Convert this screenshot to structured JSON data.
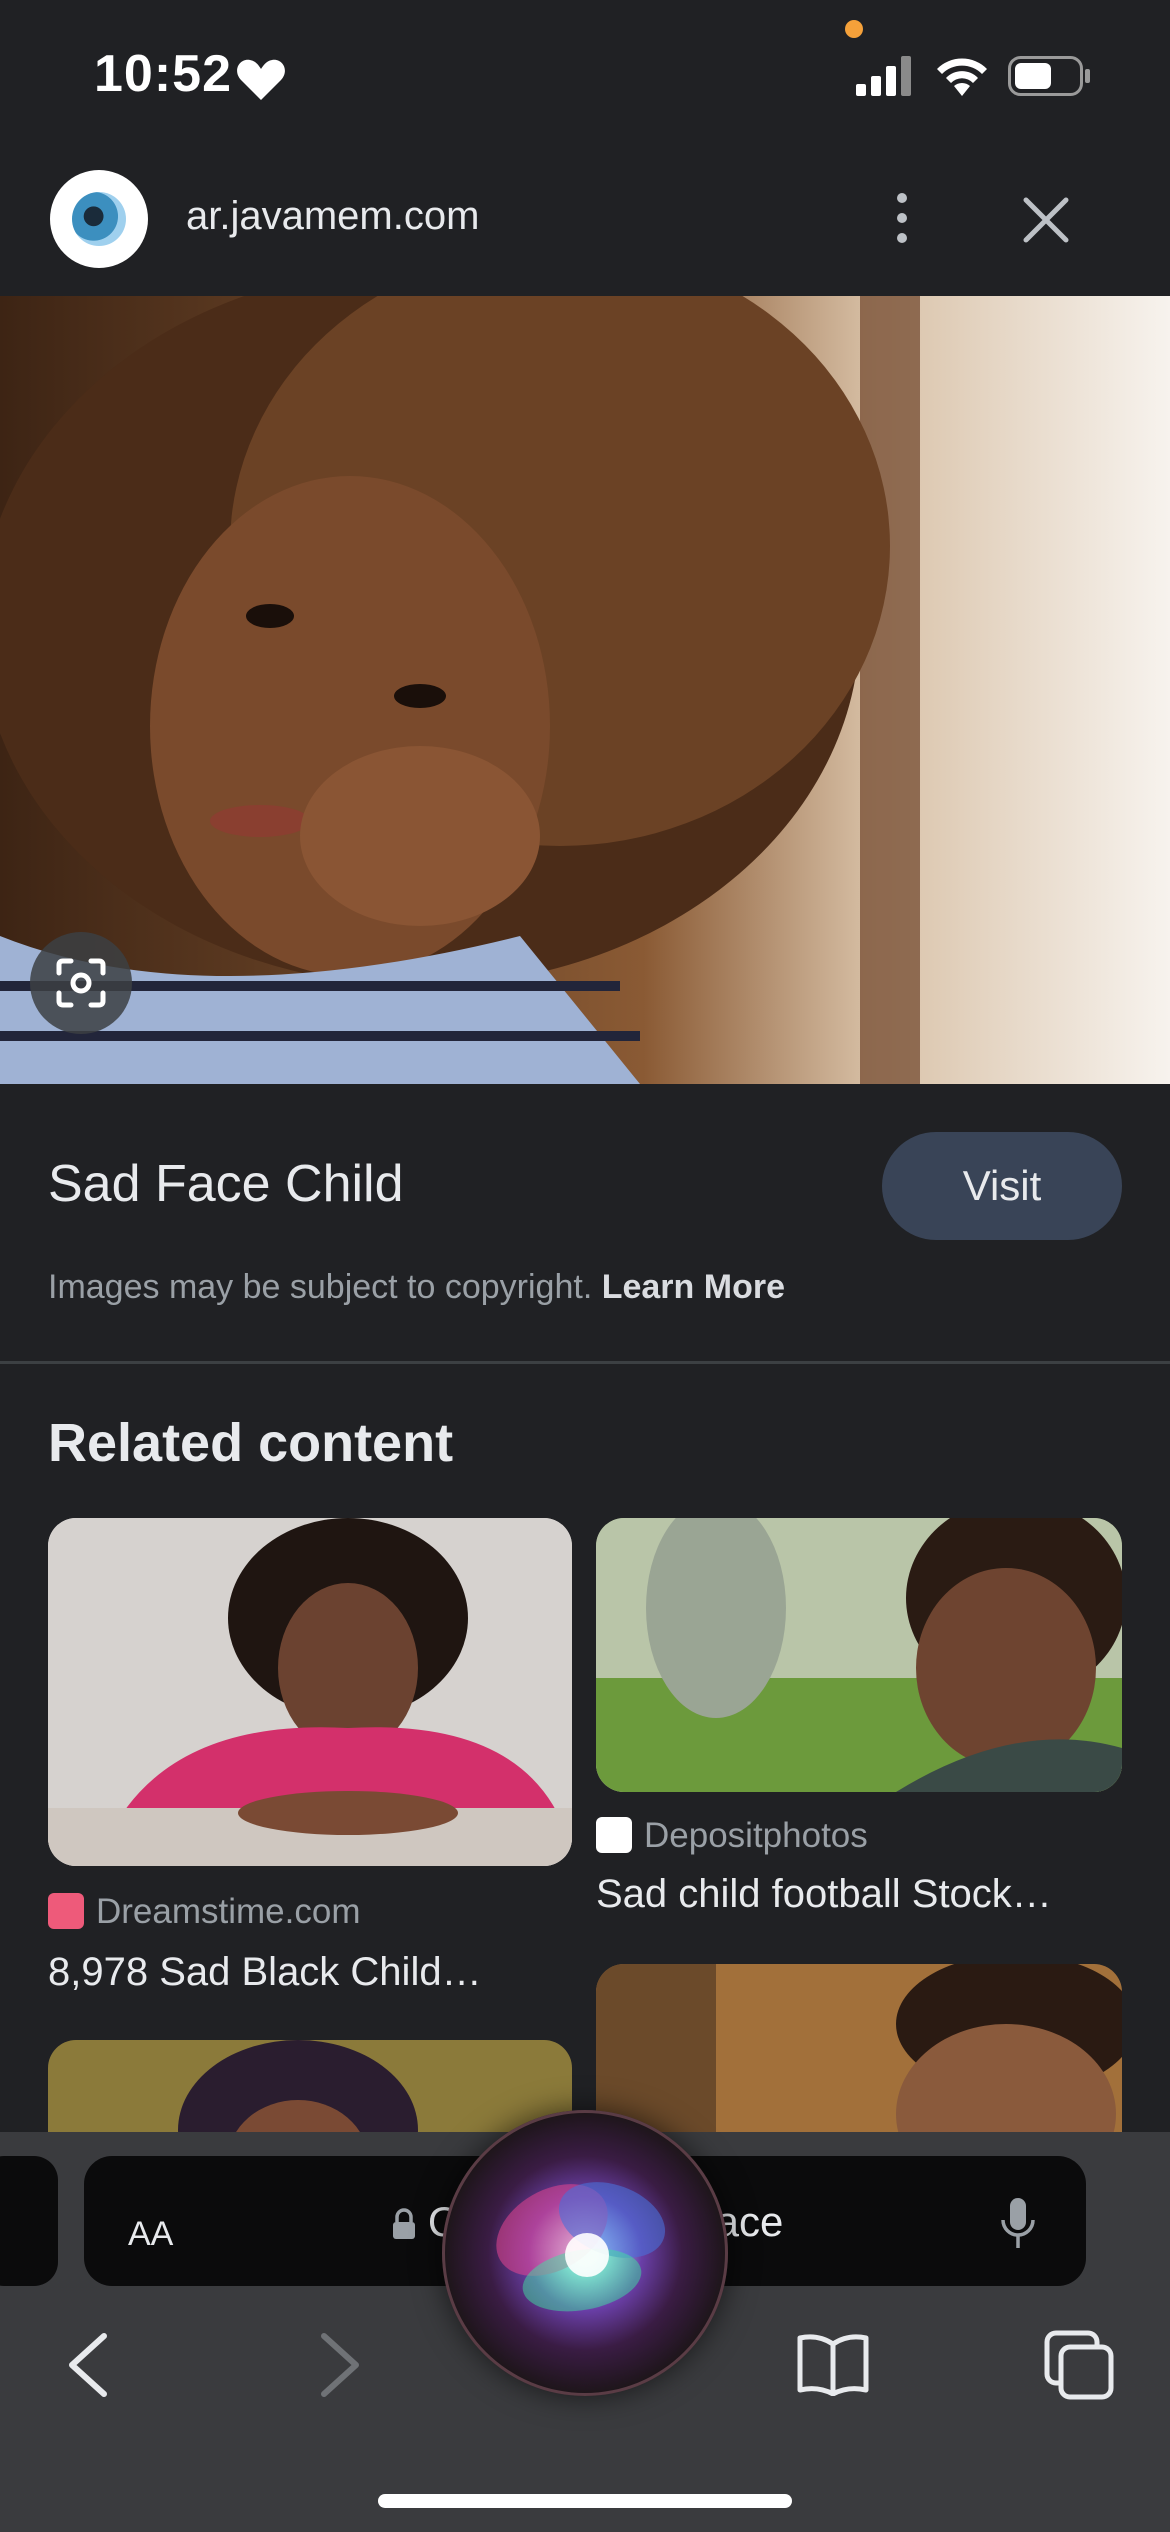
{
  "status_bar": {
    "time": "10:52",
    "icons": [
      "heart-icon",
      "signal-icon",
      "wifi-icon",
      "battery-icon"
    ]
  },
  "header": {
    "domain": "ar.javamem.com",
    "icons": [
      "site-favicon",
      "more-vert-icon",
      "close-icon"
    ]
  },
  "result": {
    "title": "Sad Face Child",
    "visit_label": "Visit",
    "copyright_text": "Images may be subject to copyright.",
    "learn_more_label": "Learn More"
  },
  "related": {
    "heading": "Related content",
    "items": [
      {
        "source": "Dreamstime.com",
        "title": "8,978 Sad Black Child…"
      },
      {
        "source": "Depositphotos",
        "title": "Sad child football Stock…"
      }
    ]
  },
  "bottom_bar": {
    "aa_label": "AA",
    "address_prefix": "Q",
    "address_suffix": "face",
    "icons": [
      "back-icon",
      "forward-icon",
      "bookmarks-icon",
      "tabs-icon",
      "microphone-icon",
      "lock-icon"
    ]
  },
  "colors": {
    "background": "#202124",
    "visit_button": "#394457",
    "toolbar": "#3a3b3e",
    "status_dot": "#f5a13a"
  }
}
